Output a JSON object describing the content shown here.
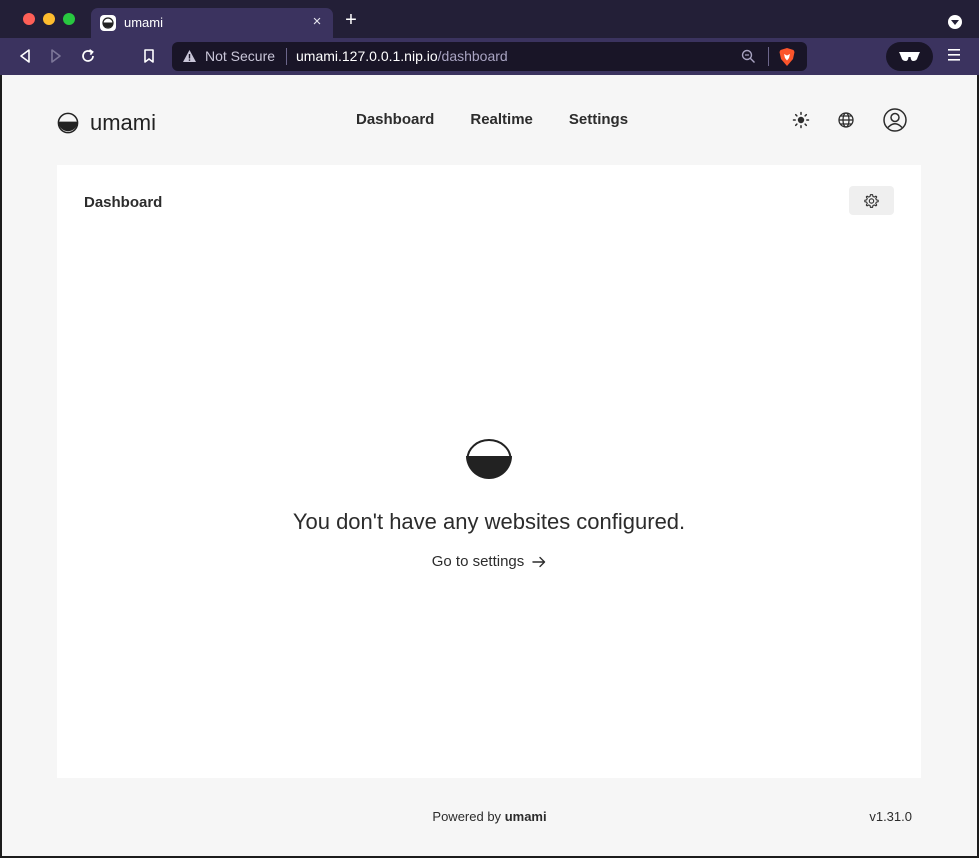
{
  "browser": {
    "tab_title": "umami",
    "tab_close": "×",
    "new_tab": "+",
    "security_label": "Not Secure",
    "url_host": "umami.127.0.0.1.nip.io",
    "url_path": "/dashboard",
    "icons": [
      "back-icon",
      "forward-icon",
      "reload-icon",
      "bookmark-icon",
      "warning-icon",
      "zoom-icon",
      "brave-shield-icon",
      "private-glasses-icon",
      "menu-icon"
    ]
  },
  "header": {
    "logo_text": "umami",
    "nav": [
      {
        "label": "Dashboard"
      },
      {
        "label": "Realtime"
      },
      {
        "label": "Settings"
      }
    ],
    "icons": [
      "theme-sun-icon",
      "language-globe-icon",
      "profile-icon"
    ]
  },
  "card": {
    "title": "Dashboard",
    "empty_message": "You don't have any websites configured.",
    "settings_link": "Go to settings"
  },
  "footer": {
    "powered_prefix": "Powered by",
    "powered_brand": "umami",
    "version": "v1.31.0"
  },
  "colors": {
    "chrome_dark": "#231f37",
    "chrome_toolbar": "#3b335f",
    "page_bg": "#f6f6f6",
    "card_bg": "#ffffff",
    "text": "#2c2c2c"
  }
}
